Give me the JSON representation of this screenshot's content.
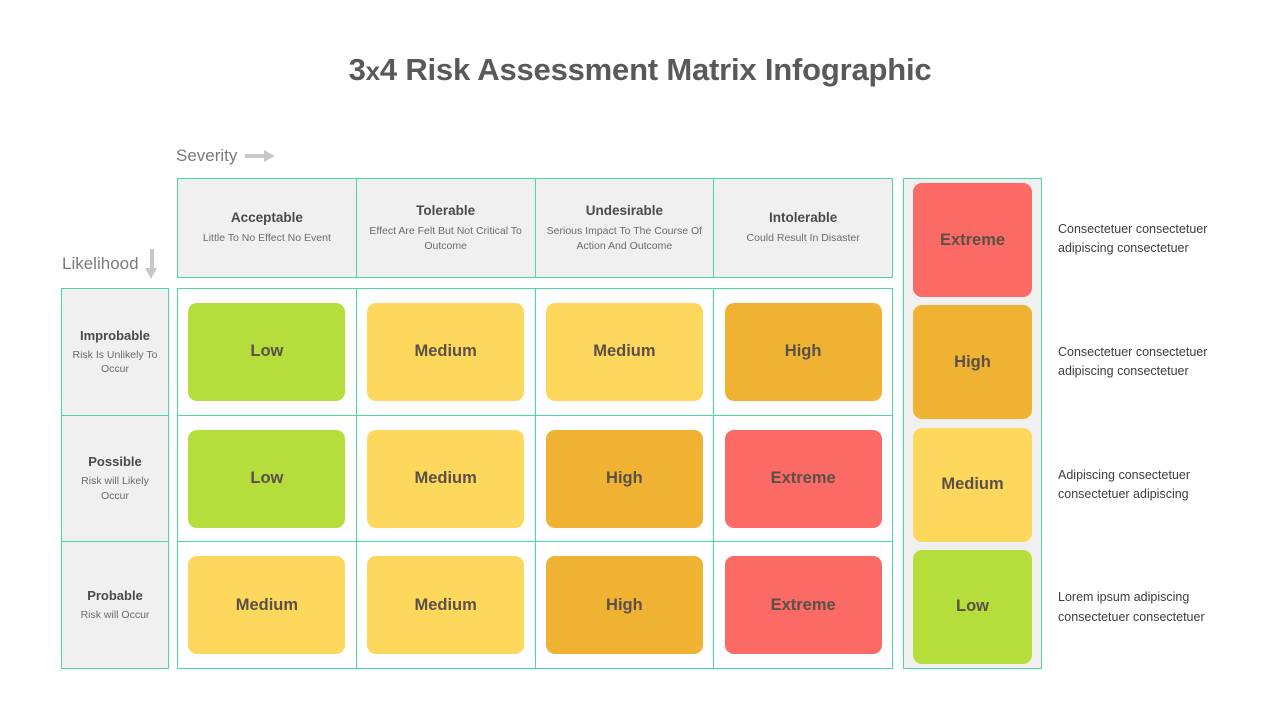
{
  "title": "3x4 Risk Assessment Matrix Infographic",
  "title_prefix": "3",
  "title_x": "x",
  "title_suffix": "4 Risk Assessment Matrix Infographic",
  "axes": {
    "severity_label": "Severity",
    "likelihood_label": "Likelihood"
  },
  "colors": {
    "low": "#b5dd3c",
    "medium": "#fdd85d",
    "high": "#f0b233",
    "extreme": "#fb6a64",
    "border": "#4cd9a0",
    "panel_bg": "#f0f0f0",
    "text": "#4a4a4a"
  },
  "severity_headers": [
    {
      "title": "Acceptable",
      "desc": "Little To No Effect No Event"
    },
    {
      "title": "Tolerable",
      "desc": "Effect Are Felt But Not Critical To Outcome"
    },
    {
      "title": "Undesirable",
      "desc": "Serious Impact To The Course Of Action And Outcome"
    },
    {
      "title": "Intolerable",
      "desc": "Could Result In Disaster"
    }
  ],
  "likelihood_rows": [
    {
      "title": "Improbable",
      "desc": "Risk Is Unlikely To Occur"
    },
    {
      "title": "Possible",
      "desc": "Risk will Likely Occur"
    },
    {
      "title": "Probable",
      "desc": "Risk will Occur"
    }
  ],
  "matrix": [
    [
      {
        "label": "Low",
        "color": "#b5dd3c"
      },
      {
        "label": "Medium",
        "color": "#fdd85d"
      },
      {
        "label": "Medium",
        "color": "#fdd85d"
      },
      {
        "label": "High",
        "color": "#f0b233"
      }
    ],
    [
      {
        "label": "Low",
        "color": "#b5dd3c"
      },
      {
        "label": "Medium",
        "color": "#fdd85d"
      },
      {
        "label": "High",
        "color": "#f0b233"
      },
      {
        "label": "Extreme",
        "color": "#fb6a64"
      }
    ],
    [
      {
        "label": "Medium",
        "color": "#fdd85d"
      },
      {
        "label": "Medium",
        "color": "#fdd85d"
      },
      {
        "label": "High",
        "color": "#f0b233"
      },
      {
        "label": "Extreme",
        "color": "#fb6a64"
      }
    ]
  ],
  "legend": [
    {
      "label": "Extreme",
      "color": "#fb6a64",
      "text": "Consectetuer consectetuer adipiscing consectetuer"
    },
    {
      "label": "High",
      "color": "#f0b233",
      "text": "Consectetuer consectetuer adipiscing consectetuer"
    },
    {
      "label": "Medium",
      "color": "#fdd85d",
      "text": "Adipiscing consectetuer consectetuer adipiscing"
    },
    {
      "label": "Low",
      "color": "#b5dd3c",
      "text": "Lorem ipsum adipiscing consectetuer consectetuer"
    }
  ]
}
